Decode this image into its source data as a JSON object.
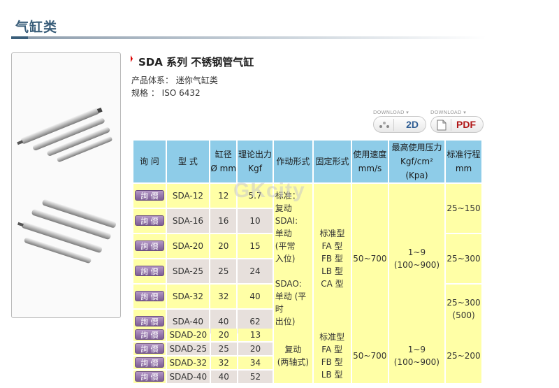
{
  "section_title": "气缸类",
  "product": {
    "title": "SDA 系列 不锈钢管气缸",
    "system_label": "产品体系：",
    "system_value": "迷你气缸类",
    "spec_label": "规格 ：",
    "spec_value": "ISO 6432"
  },
  "downloads": {
    "caption": "DOWNLOAD",
    "btn_2d": "2D",
    "btn_pdf": "PDF"
  },
  "table": {
    "headers": [
      "询 问",
      "型 式",
      "缸径\nØ mm",
      "理论出力\nKgf",
      "作动形式",
      "固定形式",
      "使用速度\nmm/s",
      "最高使用压力\nKgf/cm² (Kpa)",
      "标准行程\nmm"
    ],
    "inquiry_label": "詢 價",
    "rows": [
      {
        "model": "SDA-12",
        "bore": "12",
        "force": "5.7"
      },
      {
        "model": "SDA-16",
        "bore": "16",
        "force": "10"
      },
      {
        "model": "SDA-20",
        "bore": "20",
        "force": "15"
      },
      {
        "model": "SDA-25",
        "bore": "25",
        "force": "24"
      },
      {
        "model": "SDA-32",
        "bore": "32",
        "force": "40"
      },
      {
        "model": "SDA-40",
        "bore": "40",
        "force": "62"
      }
    ],
    "action_type": "标准：\n复动\nSDAI:\n单动\n(平常\n入位)\n\nSDAO:\n单动 (平时\n出位)",
    "mount_type": "标准型\nFA 型\nFB 型\nLB 型\nCA 型",
    "speed": "50~700",
    "pressure": "1~9\n(100~900)",
    "strokes": [
      "25~150",
      "25~300",
      "25~300\n(500)"
    ]
  },
  "table2": {
    "rows": [
      {
        "model": "SDAD-20",
        "bore": "20",
        "force": "13"
      },
      {
        "model": "SDAD-25",
        "bore": "25",
        "force": "20"
      },
      {
        "model": "SDAD-32",
        "bore": "32",
        "force": "34"
      },
      {
        "model": "SDAD-40",
        "bore": "40",
        "force": "52"
      }
    ],
    "action_type": "复动\n(两轴式)",
    "mount_type": "标准型\nFA 型\nFB 型\nLB 型",
    "speed": "50~700",
    "pressure": "1~9\n(100~900)",
    "stroke": "25~200"
  },
  "watermark": "GKcity"
}
